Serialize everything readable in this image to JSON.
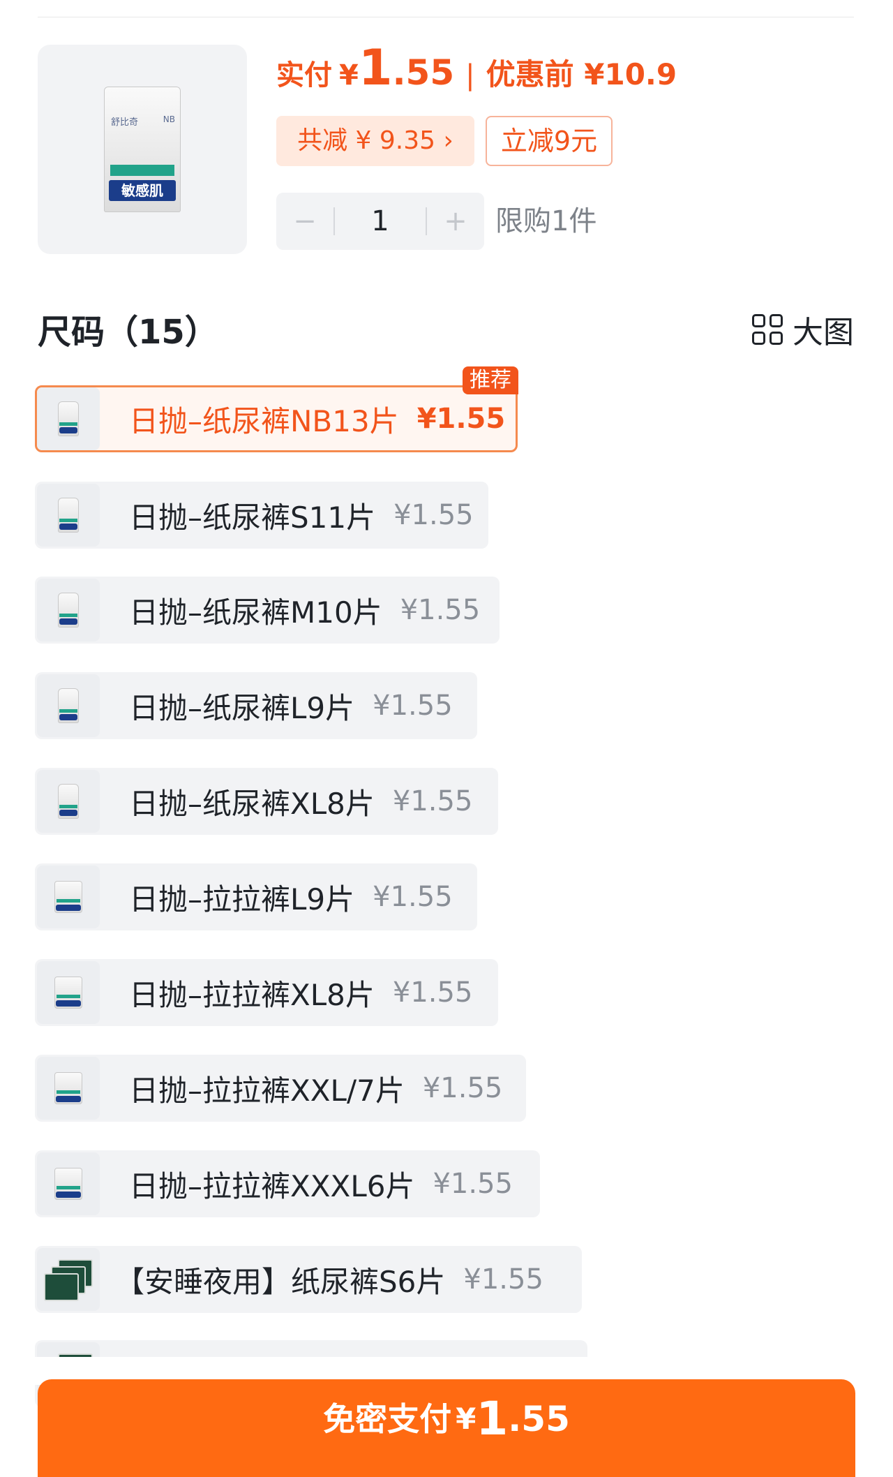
{
  "product": {
    "pack_brand": "舒比奇",
    "pack_size": "NB",
    "pack_label": "敏感肌",
    "paid_label": "实付",
    "currency": "¥",
    "paid_int": "1",
    "paid_dec": ".55",
    "separator": "|",
    "pre_discount": "优惠前 ¥10.9",
    "save_tag": "共减 ¥ 9.35 ›",
    "instant_cut": "立减9元",
    "minus": "−",
    "quantity": "1",
    "plus": "+",
    "limit": "限购1件"
  },
  "section": {
    "title": "尺码（15）",
    "big_view": "大图"
  },
  "options": [
    {
      "name": "日抛–纸尿裤NB13片",
      "price": "¥1.55",
      "selected": true,
      "badge": "推荐",
      "icon": "diaper-pack-icon"
    },
    {
      "name": "日抛–纸尿裤S11片",
      "price": "¥1.55",
      "icon": "diaper-pack-icon"
    },
    {
      "name": "日抛–纸尿裤M10片",
      "price": "¥1.55",
      "icon": "diaper-pack-icon"
    },
    {
      "name": "日抛–纸尿裤L9片",
      "price": "¥1.55",
      "icon": "diaper-pack-icon"
    },
    {
      "name": "日抛–纸尿裤XL8片",
      "price": "¥1.55",
      "icon": "diaper-pack-icon"
    },
    {
      "name": "日抛–拉拉裤L9片",
      "price": "¥1.55",
      "icon": "pull-up-pack-icon"
    },
    {
      "name": "日抛–拉拉裤XL8片",
      "price": "¥1.55",
      "icon": "pull-up-pack-icon"
    },
    {
      "name": "日抛–拉拉裤XXL/7片",
      "price": "¥1.55",
      "icon": "pull-up-pack-icon"
    },
    {
      "name": "日抛–拉拉裤XXXL6片",
      "price": "¥1.55",
      "icon": "pull-up-pack-icon"
    },
    {
      "name": "【安睡夜用】纸尿裤S6片",
      "price": "¥1.55",
      "icon": "night-pack-icon"
    }
  ],
  "pay_button": {
    "label": "免密支付",
    "currency": "¥",
    "int": "1",
    "dec": ".55"
  },
  "colors": {
    "accent": "#f2541b",
    "pay_button": "#ff6a12",
    "option_bg": "#f2f3f5"
  }
}
